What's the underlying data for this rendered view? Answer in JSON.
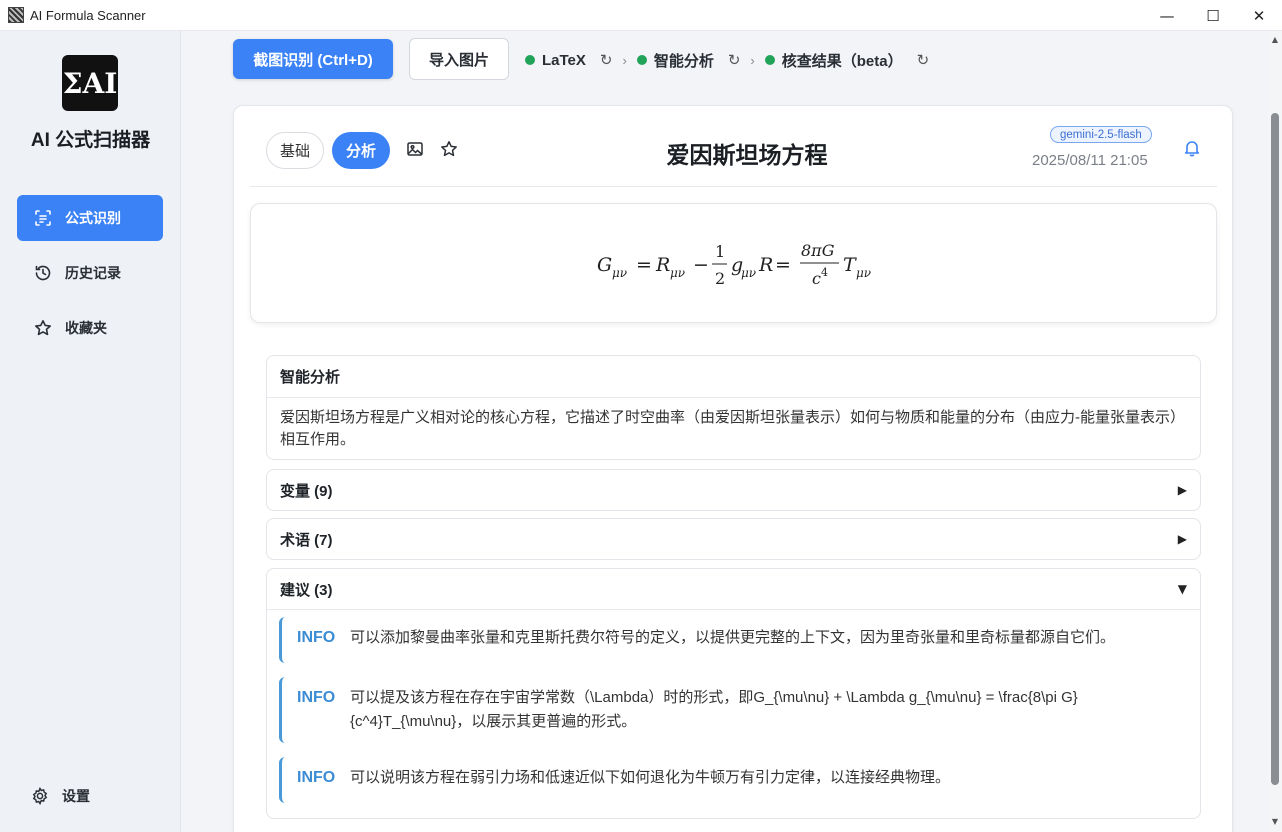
{
  "window": {
    "title": "AI Formula Scanner",
    "minimize": "—",
    "maximize": "☐",
    "close": "✕"
  },
  "sidebar": {
    "app_name": "AI 公式扫描器",
    "logo_text": "ΣAI",
    "items": [
      {
        "label": "公式识别",
        "icon": "scan-text-icon",
        "active": true
      },
      {
        "label": "历史记录",
        "icon": "history-icon",
        "active": false
      },
      {
        "label": "收藏夹",
        "icon": "star-icon",
        "active": false
      }
    ],
    "settings_label": "设置"
  },
  "toolbar": {
    "capture_label": "截图识别 (Ctrl+D)",
    "import_label": "导入图片",
    "pipeline": [
      {
        "label": "LaTeX",
        "status": "done"
      },
      {
        "label": "智能分析",
        "status": "done"
      },
      {
        "label": "核查结果（beta）",
        "status": "done"
      }
    ],
    "refresh_glyph": "↻",
    "separator_glyph": "›"
  },
  "result": {
    "tabs": [
      {
        "label": "基础",
        "active": false
      },
      {
        "label": "分析",
        "active": true
      }
    ],
    "title": "爱因斯坦场方程",
    "model_badge": "gemini-2.5-flash",
    "timestamp": "2025/08/11 21:05",
    "formula_latex": "G_{\\mu\\nu} = R_{\\mu\\nu} - \\frac{1}{2} g_{\\mu\\nu} R = \\frac{8\\pi G}{c^4} T_{\\mu\\nu}",
    "formula_parts": {
      "G": "G",
      "mn": "μν",
      "eq": "=",
      "R": "R",
      "minus": "−",
      "one": "1",
      "two": "2",
      "g": "g",
      "eightpiG": "8πG",
      "c": "c",
      "four": "4",
      "T": "T"
    }
  },
  "analysis": {
    "title": "智能分析",
    "text": "爱因斯坦场方程是广义相对论的核心方程，它描述了时空曲率（由爱因斯坦张量表示）如何与物质和能量的分布（由应力-能量张量表示）相互作用。"
  },
  "sections": {
    "variables": {
      "label": "变量 (9)",
      "arrow": "▶"
    },
    "terms": {
      "label": "术语 (7)",
      "arrow": "▶"
    },
    "suggestions": {
      "label": "建议 (3)",
      "arrow": "▼"
    }
  },
  "suggestions": [
    {
      "tag": "INFO",
      "text": "可以添加黎曼曲率张量和克里斯托费尔符号的定义，以提供更完整的上下文，因为里奇张量和里奇标量都源自它们。"
    },
    {
      "tag": "INFO",
      "text": "可以提及该方程在存在宇宙学常数（\\Lambda）时的形式，即G_{\\mu\\nu} + \\Lambda g_{\\mu\\nu} = \\frac{8\\pi G}{c^4}T_{\\mu\\nu}，以展示其更普遍的形式。"
    },
    {
      "tag": "INFO",
      "text": "可以说明该方程在弱引力场和低速近似下如何退化为牛顿万有引力定律，以连接经典物理。"
    }
  ],
  "colors": {
    "accent": "#3b82f6",
    "status_dot": "#22a35a",
    "info_tag": "#3b8cd4",
    "badge_border": "#7aa6f0"
  }
}
